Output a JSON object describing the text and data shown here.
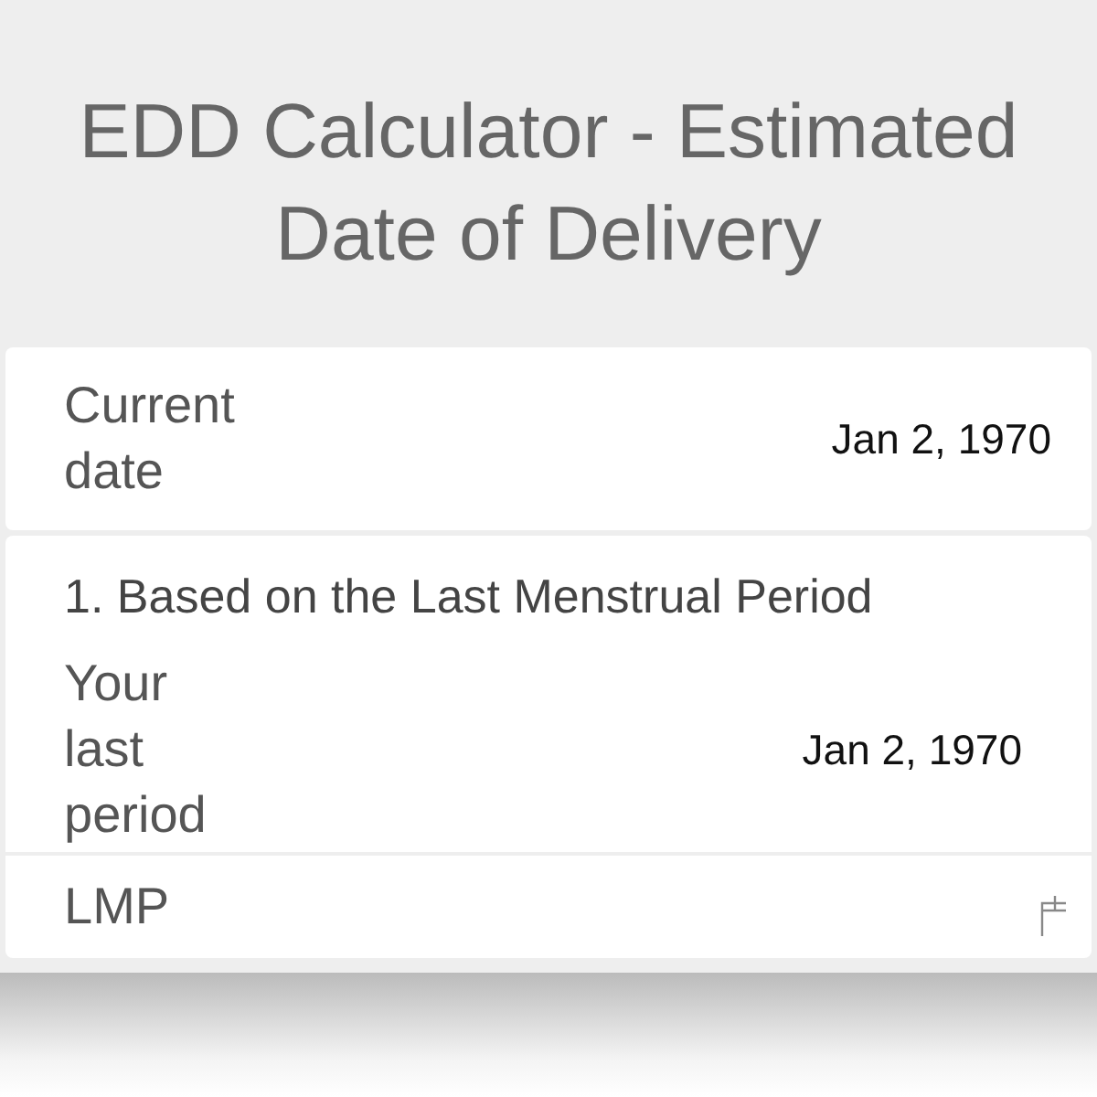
{
  "title": "EDD Calculator - Estimated Date of Delivery",
  "current": {
    "label": "Current date",
    "value": "Jan 2, 1970"
  },
  "section": {
    "heading": "1. Based on the Last Menstrual Period",
    "rows": [
      {
        "kind": "value",
        "label": "Your last period",
        "value": "Jan 2, 1970"
      },
      {
        "kind": "date-input",
        "label": "LMP"
      }
    ]
  }
}
